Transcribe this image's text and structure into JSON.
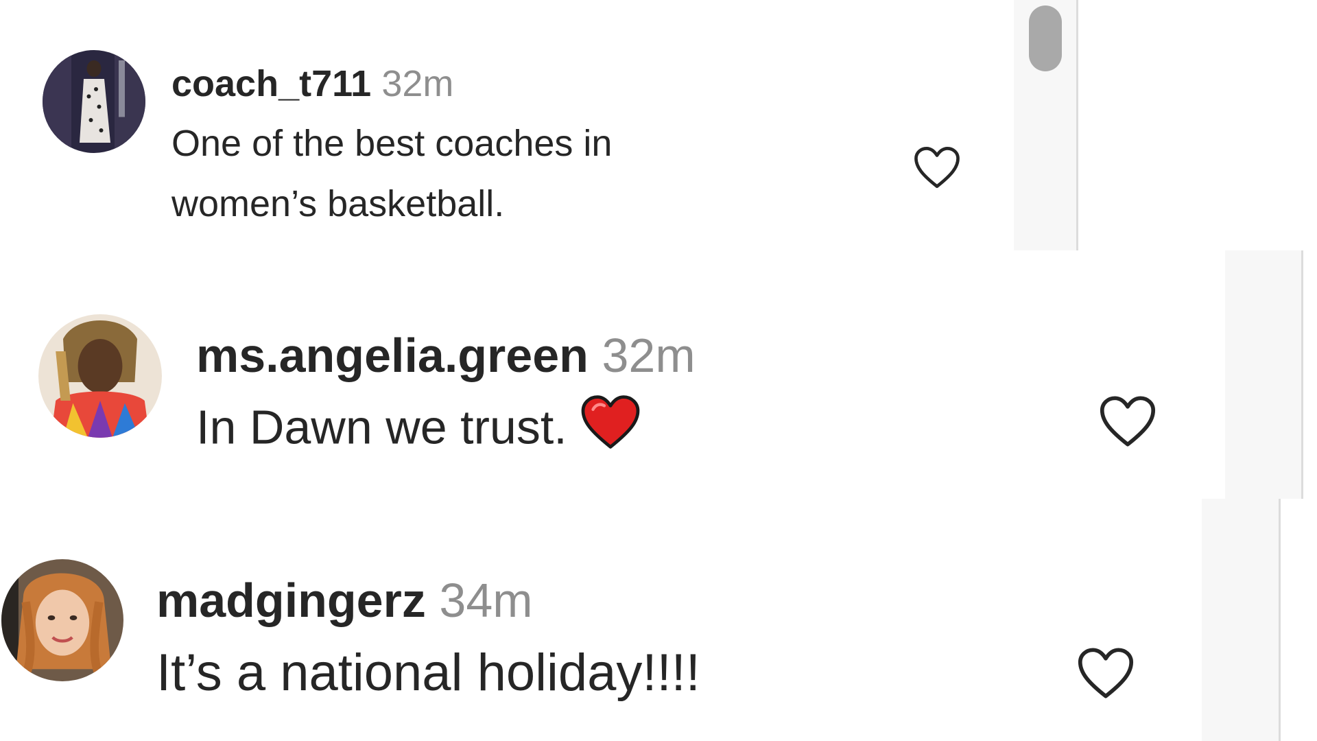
{
  "comments": [
    {
      "username": "coach_t711",
      "time": "32m",
      "text": "One of the best coaches in women’s basketball.",
      "avatar": "avatar-photo",
      "like_icon": "heart-outline-icon"
    },
    {
      "username": "ms.angelia.green",
      "time": "32m",
      "text": "In Dawn we trust.",
      "emoji": "red-heart-emoji",
      "avatar": "avatar-photo",
      "like_icon": "heart-outline-icon"
    },
    {
      "username": "madgingerz",
      "time": "34m",
      "text": "It’s a national holiday!!!!",
      "avatar": "avatar-photo",
      "like_icon": "heart-outline-icon"
    }
  ],
  "colors": {
    "username": "#262626",
    "timestamp": "#8e8e8e",
    "like_icon": "#262626",
    "emoji_heart": "#e02020",
    "scrollbar_thumb": "#a9a9a9",
    "scroll_track": "#f7f7f7"
  }
}
